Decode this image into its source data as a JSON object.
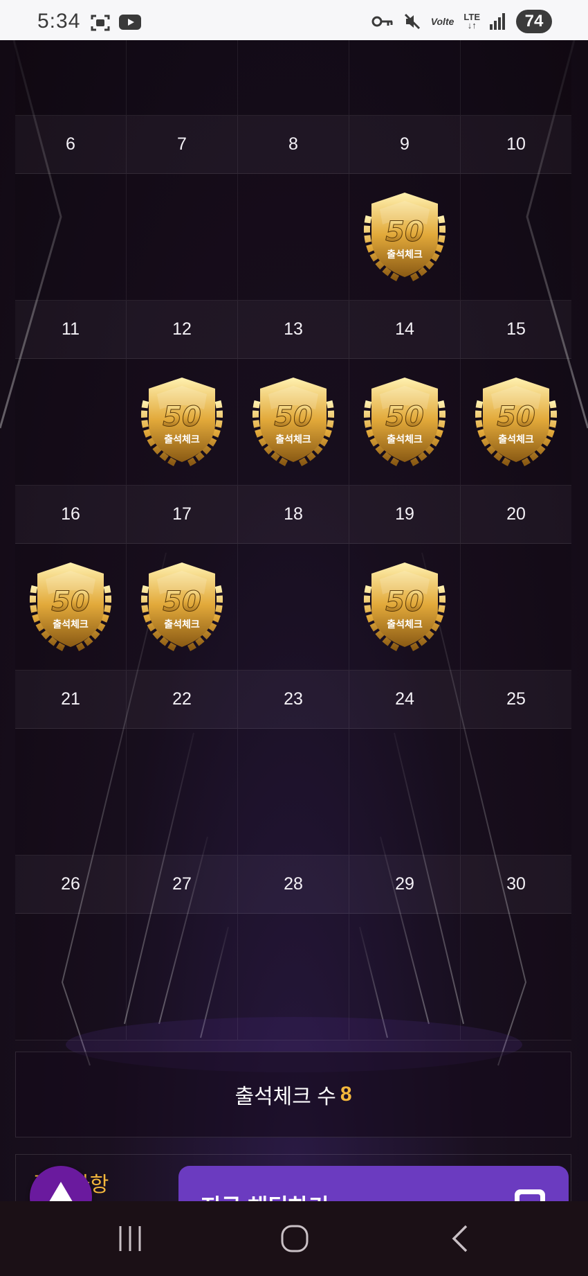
{
  "status_bar": {
    "time": "5:34",
    "battery": "74",
    "network": "LTE",
    "volte": "Volte",
    "icons": [
      "screenshot-icon",
      "youtube-icon",
      "key-icon",
      "mute-icon",
      "volte-icon",
      "lte-icon",
      "signal-icon",
      "battery-icon"
    ]
  },
  "calendar": {
    "weeks": [
      {
        "dates": [
          "6",
          "7",
          "8",
          "9",
          "10"
        ],
        "stamps": [
          false,
          false,
          false,
          true,
          false
        ]
      },
      {
        "dates": [
          "11",
          "12",
          "13",
          "14",
          "15"
        ],
        "stamps": [
          false,
          true,
          true,
          true,
          true
        ]
      },
      {
        "dates": [
          "16",
          "17",
          "18",
          "19",
          "20"
        ],
        "stamps": [
          true,
          true,
          false,
          true,
          false
        ]
      },
      {
        "dates": [
          "21",
          "22",
          "23",
          "24",
          "25"
        ],
        "stamps": [
          false,
          false,
          false,
          false,
          false
        ]
      },
      {
        "dates": [
          "26",
          "27",
          "28",
          "29",
          "30"
        ],
        "stamps": [
          false,
          false,
          false,
          false,
          false
        ]
      }
    ],
    "badge": {
      "number": "50",
      "label": "출석체크"
    }
  },
  "counter": {
    "label": "출석체크 수",
    "value": "8"
  },
  "notice": {
    "label": "주의사항"
  },
  "chat": {
    "label": "지금 채팅하기"
  },
  "colors": {
    "accent_gold": "#f4b73c",
    "chat_purple": "#6b3bc0",
    "scroll_button": "#6a1a9e"
  }
}
